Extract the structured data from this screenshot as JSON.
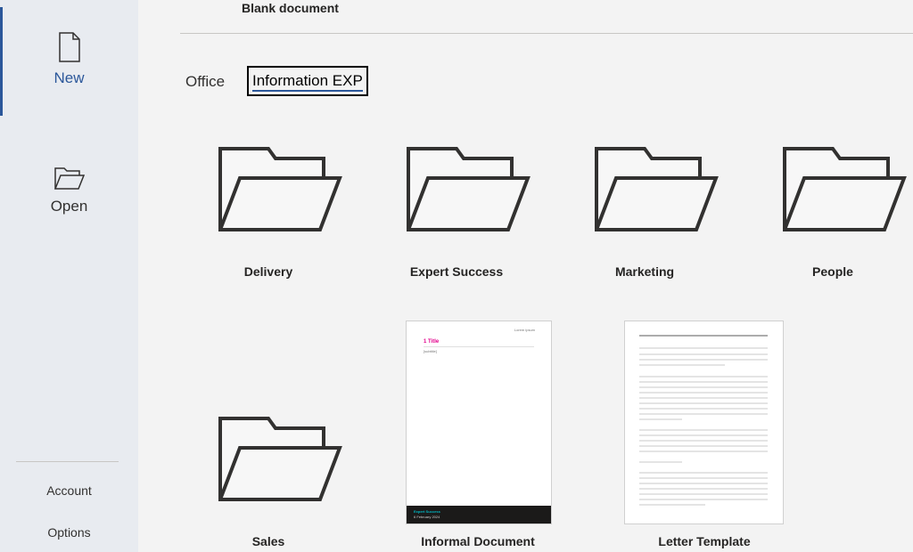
{
  "sidebar": {
    "new_label": "New",
    "open_label": "Open",
    "account_label": "Account",
    "options_label": "Options"
  },
  "main": {
    "blank_document_label": "Blank document",
    "tabs": [
      {
        "label": "Office",
        "selected": false
      },
      {
        "label": "Information EXP",
        "selected": true
      }
    ],
    "templates": [
      {
        "label": "Delivery",
        "icon": "folder-icon"
      },
      {
        "label": "Expert Success",
        "icon": "folder-icon"
      },
      {
        "label": "Marketing",
        "icon": "folder-icon"
      },
      {
        "label": "People",
        "icon": "folder-icon"
      },
      {
        "label": "Sales",
        "icon": "folder-icon"
      },
      {
        "label": "Informal Document",
        "icon": "document-thumbnail",
        "preview": {
          "heading": "1 Title",
          "subtext": "[subtitle]",
          "footer_title": "Expert Success",
          "footer_date": "6 February 2024",
          "corner": "Lorem ipsum"
        }
      },
      {
        "label": "Letter Template",
        "icon": "document-thumbnail"
      }
    ]
  },
  "colors": {
    "accent": "#2b579a",
    "sidebar_bg": "#e8ebf0",
    "main_bg": "#f3f3f3",
    "preview_heading": "#e3008c",
    "preview_footer": "#1b1a19",
    "preview_footer_text": "#00b7c3"
  }
}
